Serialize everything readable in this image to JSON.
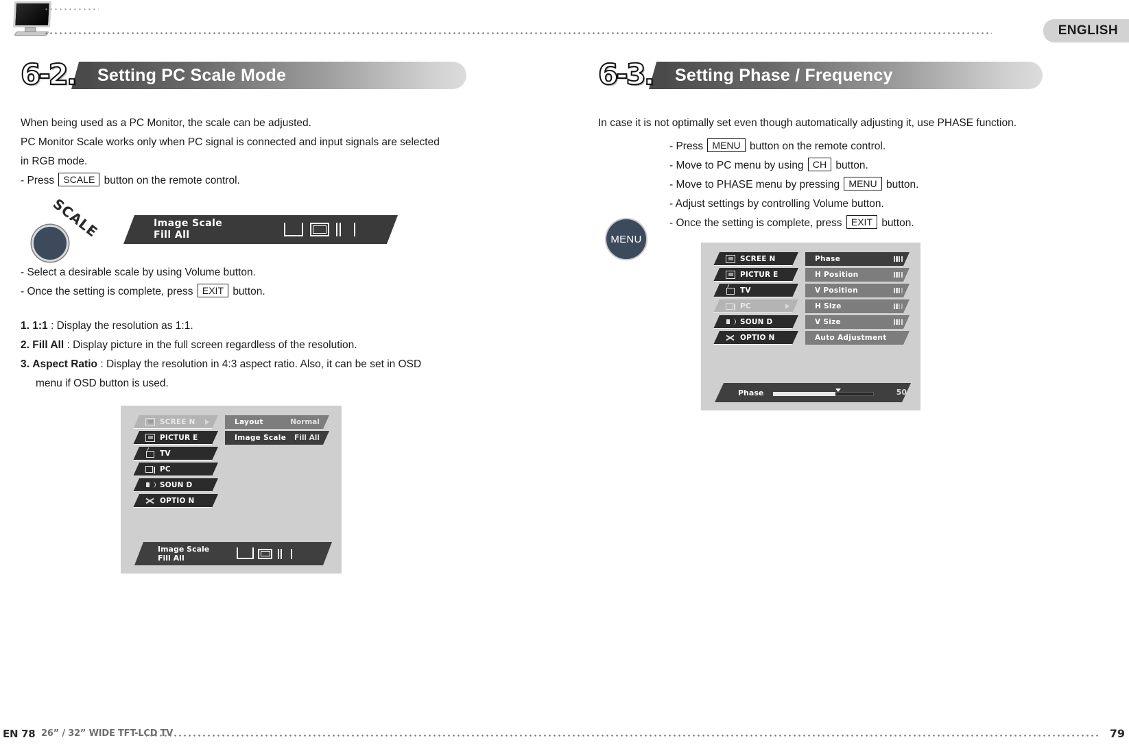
{
  "header": {
    "language_tab": "ENGLISH",
    "tv_icon": "tv-icon"
  },
  "left_section": {
    "number": "6-2.",
    "title": "Setting PC Scale Mode",
    "intro": [
      "When being used as a PC Monitor, the scale can be adjusted.",
      "PC Monitor Scale works only when PC signal is connected and input signals are selected",
      "in RGB mode."
    ],
    "press_line": {
      "pre": "- Press",
      "key": "SCALE",
      "post": "button on the remote control."
    },
    "knob_label": "SCALE",
    "osd_strip": {
      "title": "Image Scale",
      "value": "Fill All"
    },
    "after_lines": [
      {
        "text": "- Select a desirable scale by using Volume button."
      }
    ],
    "exit_line": {
      "pre": "- Once the setting is complete, press",
      "key": "EXIT",
      "post": "button."
    },
    "numbered": [
      {
        "num": "1.",
        "label": "1:1",
        "sep": ":",
        "text": "Display the resolution as 1:1."
      },
      {
        "num": "2.",
        "label": "Fill All",
        "sep": ":",
        "text": "Display picture in the full screen regardless of the resolution."
      },
      {
        "num": "3.",
        "label": "Aspect Ratio",
        "sep": ":",
        "text": "Display the resolution in 4:3 aspect ratio. Also, it can be set in OSD",
        "text2": "menu if OSD button is used."
      }
    ],
    "osd": {
      "menu_items": [
        {
          "label": "SCREE N",
          "icon": "screen-icon",
          "selected": true,
          "arrow": true
        },
        {
          "label": "PICTUR E",
          "icon": "picture-icon",
          "selected": false,
          "arrow": false
        },
        {
          "label": "TV",
          "icon": "tv-menu-icon",
          "selected": false,
          "arrow": false
        },
        {
          "label": "PC",
          "icon": "pc-icon",
          "selected": false,
          "arrow": false
        },
        {
          "label": "SOUN D",
          "icon": "sound-icon",
          "selected": false,
          "arrow": false
        },
        {
          "label": "OPTIO N",
          "icon": "option-icon",
          "selected": false,
          "arrow": false
        }
      ],
      "sub_items": [
        {
          "label": "Layout",
          "value": "Normal",
          "dark": false
        },
        {
          "label": "Image Scale",
          "value": "Fill All",
          "dark": true
        }
      ],
      "bottom": {
        "title": "Image Scale",
        "value": "Fill All"
      }
    }
  },
  "right_section": {
    "number": "6-3.",
    "title": "Setting Phase / Frequency",
    "intro": "In case it is not optimally set even though automatically adjusting it, use PHASE function.",
    "knob_label": "MENU",
    "steps": [
      {
        "pre": "- Press",
        "key": "MENU",
        "post": "button on the remote control."
      },
      {
        "pre": "- Move to PC menu by using",
        "key": "CH",
        "post": "button."
      },
      {
        "pre": "- Move to PHASE menu by pressing",
        "key": "MENU",
        "post": "button."
      },
      {
        "pre": "- Adjust settings by controlling Volume button.",
        "key": "",
        "post": ""
      },
      {
        "pre": "- Once the setting is complete, press",
        "key": "EXIT",
        "post": "button."
      }
    ],
    "osd": {
      "menu_items": [
        {
          "label": "SCREE N",
          "icon": "screen-icon",
          "selected": false,
          "arrow": false
        },
        {
          "label": "PICTUR E",
          "icon": "picture-icon",
          "selected": false,
          "arrow": false
        },
        {
          "label": "TV",
          "icon": "tv-menu-icon",
          "selected": false,
          "arrow": false
        },
        {
          "label": "PC",
          "icon": "pc-icon",
          "selected": true,
          "arrow": true
        },
        {
          "label": "SOUN D",
          "icon": "sound-icon",
          "selected": false,
          "arrow": false
        },
        {
          "label": "OPTIO N",
          "icon": "option-icon",
          "selected": false,
          "arrow": false
        }
      ],
      "sub_items": [
        {
          "label": "Phase",
          "bars": 4,
          "dark": true
        },
        {
          "label": "H Position",
          "bars": 4,
          "dark": false
        },
        {
          "label": "V Position",
          "bars": 3,
          "dark": false
        },
        {
          "label": "H Size",
          "bars": 2,
          "dark": false
        },
        {
          "label": "V Size",
          "bars": 4,
          "dark": false
        },
        {
          "label": "Auto Adjustment",
          "bars": 0,
          "dark": false
        }
      ],
      "bottom": {
        "title": "Phase",
        "value": "50"
      }
    }
  },
  "footer": {
    "page_left": "EN 78",
    "model": "26” / 32” WIDE TFT-LCD TV",
    "page_right": "79"
  }
}
